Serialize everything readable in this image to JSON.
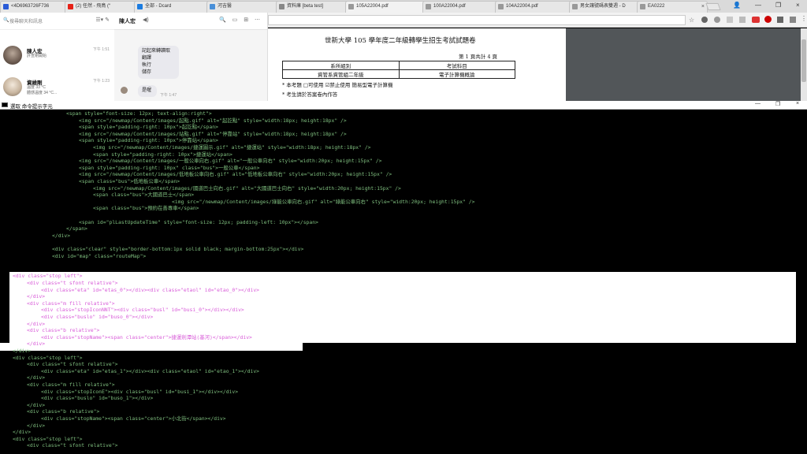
{
  "browser": {
    "tabs": [
      {
        "label": "<4D6963726F736",
        "favicon_color": "#2a5bd7"
      },
      {
        "label": "(2) 任然 - 飛鳥 (“",
        "favicon_color": "#e62117"
      },
      {
        "label": "全部 - Dcard",
        "favicon_color": "#1c7ce0"
      },
      {
        "label": "河吉醫",
        "favicon_color": "#4a90d9"
      },
      {
        "label": "資料庫 [beta test]",
        "favicon_color": "#888888"
      },
      {
        "label": "105A22004.pdf",
        "favicon_color": "#999999"
      },
      {
        "label": "100A22004.pdf",
        "favicon_color": "#999999"
      },
      {
        "label": "104A22004.pdf",
        "favicon_color": "#999999"
      },
      {
        "label": "男女讓號碼表雙週 - D",
        "favicon_color": "#999999"
      },
      {
        "label": "EA0222",
        "favicon_color": "#999999"
      }
    ],
    "close_glyph": "×",
    "window_controls": [
      "—",
      "❐",
      "×"
    ],
    "star_glyph": "☆"
  },
  "chat": {
    "search_placeholder": "搜尋聊天和訊息",
    "list_tools": "☰▾ ✎",
    "contacts": [
      {
        "name": "陳人宏",
        "sub": "許宣剛開始",
        "time": "下午 1:51"
      },
      {
        "name": "資維剛",
        "sub": "溫度 33 °C\n體感溫度 34 °C...",
        "time": "下午 1:23"
      }
    ],
    "conversation": {
      "title": "陳人宏",
      "speaker_glyph": "◀)",
      "tools": "🔍 ▭ ⊞ ⋯",
      "message_lines": [
        "記起來轉讀取",
        "翻譯",
        "執行",
        "儲存"
      ],
      "reply": "是喔",
      "reply_time": "下午 1:47"
    }
  },
  "pdf": {
    "title": "世新大學 105 學年度二年級轉學生招生考試試題卷",
    "page_info": "第 1 頁共計  4  頁",
    "table": [
      [
        "系所組別",
        "考試科目"
      ],
      [
        "資管系資管組二年級",
        "電子計算機概論"
      ]
    ],
    "note1": "* 本考題 □可使用  ☑禁止使用  簡易型電子計算機",
    "note2": "* 考生請於答案卷內作答"
  },
  "console": {
    "title": "選取 命令提示字元",
    "controls": [
      "—",
      "❐",
      "×"
    ],
    "lines": [
      {
        "indent": 84,
        "text": "<span style=\"font-size: 12px; text-align:right\">"
      },
      {
        "indent": 100,
        "text": "<img src=\"/newmap/Content/images/起點.gif\" alt=\"起訖點\" style=\"width:18px; height:18px\" />"
      },
      {
        "indent": 100,
        "text": "<span style=\"padding-right: 10px\">起訖點</span>"
      },
      {
        "indent": 100,
        "text": "<img src=\"/newmap/Content/images/站點.gif\" alt=\"停靠站\" style=\"width:18px; height:18px\" />"
      },
      {
        "indent": 100,
        "text": "<span style=\"padding-right: 10px\">停靠站</span>"
      },
      {
        "indent": 118,
        "text": "<img src=\"/newmap/Content/images/捷運圖示.gif\" alt=\"捷運站\" style=\"width:18px; height:18px\" />"
      },
      {
        "indent": 118,
        "text": "<span style=\"padding-right: 10px\">捷運站</span>"
      },
      {
        "indent": 100,
        "text": "<img src=\"/newmap/Content/images/一般公車向右.gif\" alt=\"一般公車向右\" style=\"width:20px; height:15px\" />"
      },
      {
        "indent": 100,
        "text": "<span style=\"padding-right: 10px\" class=\"bus\">一般公車</span>"
      },
      {
        "indent": 100,
        "text": "<img src=\"/newmap/Content/images/低地板公車向右.gif\" alt=\"低地板公車向右\" style=\"width:20px; height:15px\" />"
      },
      {
        "indent": 100,
        "text": "<span class=\"bus\">低地板公車</span>"
      },
      {
        "indent": 118,
        "text": "<img src=\"/newmap/Content/images/國道巴士向右.gif\" alt=\"大國道巴士向右\" style=\"width:20px; height:15px\" />"
      },
      {
        "indent": 118,
        "text": "<span class=\"bus\">大國道巴士</span>"
      },
      {
        "indent": 218,
        "text": "<img src=\"/newmap/Content/images/綠能公車向右.gif\" alt=\"綠能公車向右\" style=\"width:20px; height:15px\" />"
      },
      {
        "indent": 118,
        "text": "<span class=\"bus\">預約在善專車</span>"
      },
      {
        "indent": 0,
        "text": ""
      },
      {
        "indent": 100,
        "text": "<span id=\"plLastUpdateTime\" style=\"font-size: 12px; padding-left: 10px\"></span>"
      },
      {
        "indent": 84,
        "text": "</span>"
      },
      {
        "indent": 66,
        "text": "</div>"
      },
      {
        "indent": 0,
        "text": ""
      },
      {
        "indent": 66,
        "text": "<div class=\"clear\" style=\"border-bottom:1px solid black; margin-bottom:25px\"></div>"
      },
      {
        "indent": 66,
        "text": "<div id=\"map\" class=\"routeMap\">"
      },
      {
        "indent": 0,
        "text": ""
      },
      {
        "indent": 0,
        "text": ""
      },
      {
        "indent": 16,
        "text": "<div class=\"stop left\">",
        "hl": true
      },
      {
        "indent": 34,
        "text": "<div class=\"t sfont relative\">",
        "hl": true
      },
      {
        "indent": 52,
        "text": "<div class=\"eta\" id=\"etas_0\"></div><div class=\"etaol\" id=\"etao_0\"></div>",
        "hl": true
      },
      {
        "indent": 34,
        "text": "</div>",
        "hl": true
      },
      {
        "indent": 34,
        "text": "<div class=\"m fill relative\">",
        "hl": true
      },
      {
        "indent": 52,
        "text": "<div class=\"stopIconNNT\"><div class=\"busl\" id=\"busi_0\"></div></div>",
        "hl": true
      },
      {
        "indent": 52,
        "text": "<div class=\"buslo\" id=\"buso_0\"></div>",
        "hl": true
      },
      {
        "indent": 34,
        "text": "</div>",
        "hl": true
      },
      {
        "indent": 34,
        "text": "<div class=\"b relative\">",
        "hl": true
      },
      {
        "indent": 52,
        "text": "<div class=\"stopName\"><span class=\"center\">捷運劍潭站(基河)</span></div>",
        "hl": true
      },
      {
        "indent": 34,
        "text": "</div>",
        "hl": true
      },
      {
        "indent": 16,
        "text": "</div>"
      },
      {
        "indent": 16,
        "text": "<div class=\"stop left\">"
      },
      {
        "indent": 34,
        "text": "<div class=\"t sfont relative\">"
      },
      {
        "indent": 52,
        "text": "<div class=\"eta\" id=\"etas_1\"></div><div class=\"etaol\" id=\"etao_1\"></div>"
      },
      {
        "indent": 34,
        "text": "</div>"
      },
      {
        "indent": 34,
        "text": "<div class=\"m fill relative\">"
      },
      {
        "indent": 52,
        "text": "<div class=\"stopIconE\"><div class=\"busl\" id=\"busi_1\"></div></div>"
      },
      {
        "indent": 52,
        "text": "<div class=\"buslo\" id=\"buso_1\"></div>"
      },
      {
        "indent": 34,
        "text": "</div>"
      },
      {
        "indent": 34,
        "text": "<div class=\"b relative\">"
      },
      {
        "indent": 52,
        "text": "<div class=\"stopName\"><span class=\"center\">小北街</span></div>"
      },
      {
        "indent": 34,
        "text": "</div>"
      },
      {
        "indent": 16,
        "text": "</div>"
      },
      {
        "indent": 16,
        "text": "<div class=\"stop left\">"
      },
      {
        "indent": 34,
        "text": "<div class=\"t sfont relative\">"
      }
    ]
  }
}
